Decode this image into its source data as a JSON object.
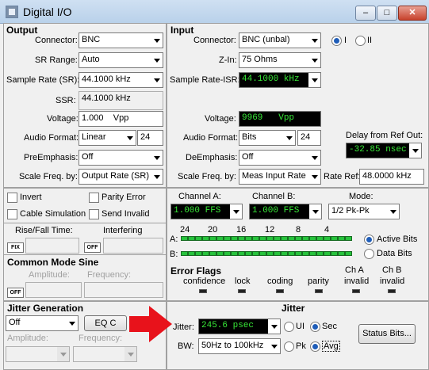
{
  "window": {
    "title": "Digital I/O",
    "minimize": "–",
    "maximize": "□",
    "close": "✕"
  },
  "output": {
    "title": "Output",
    "connector_label": "Connector:",
    "connector_value": "BNC",
    "sr_range_label": "SR Range:",
    "sr_range_value": "Auto",
    "sample_rate_label": "Sample Rate (SR):",
    "sample_rate_value": "44.1000 kHz",
    "ssr_label": "SSR:",
    "ssr_value": "44.1000 kHz",
    "voltage_label": "Voltage:",
    "voltage_value": "1.000",
    "voltage_unit": "Vpp",
    "audio_format_label": "Audio Format:",
    "audio_format_value": "Linear",
    "audio_format_bits": "24",
    "preemphasis_label": "PreEmphasis:",
    "preemphasis_value": "Off",
    "scale_freq_label": "Scale Freq. by:",
    "scale_freq_value": "Output Rate (SR)"
  },
  "input": {
    "title": "Input",
    "connector_label": "Connector:",
    "connector_value": "BNC (unbal)",
    "radio_i": "I",
    "radio_ii": "II",
    "zin_label": "Z-In:",
    "zin_value": "75 Ohms",
    "sample_rate_label": "Sample Rate-ISR:",
    "sample_rate_value": "44.1000 kHz",
    "voltage_label": "Voltage:",
    "voltage_value": "9969",
    "voltage_unit": "Vpp",
    "audio_format_label": "Audio Format:",
    "audio_format_value": "Bits",
    "audio_format_bits": "24",
    "deemphasis_label": "DeEmphasis:",
    "deemphasis_value": "Off",
    "scale_freq_label": "Scale Freq. by:",
    "scale_freq_value": "Meas Input Rate",
    "delay_label": "Delay from Ref Out:",
    "delay_value": "-32.85  nsec",
    "rate_ref_label": "Rate Ref:",
    "rate_ref_value": "48.0000 kHz"
  },
  "options": {
    "invert": "Invert",
    "parity_error": "Parity Error",
    "cable_simulation": "Cable Simulation",
    "send_invalid": "Send Invalid",
    "rise_fall_label": "Rise/Fall Time:",
    "interfering_label": "Interfering",
    "fix": "FIX",
    "off": "OFF",
    "common_mode_title": "Common Mode Sine",
    "amplitude_label": "Amplitude:",
    "frequency_label": "Frequency:"
  },
  "jitter_gen": {
    "title": "Jitter Generation",
    "mode_value": "Off",
    "eq_button": "EQ C",
    "amplitude_label": "Amplitude:",
    "frequency_label": "Frequency:"
  },
  "channels": {
    "channel_a_label": "Channel A:",
    "channel_a_value": "1.000     FFS",
    "channel_b_label": "Channel B:",
    "channel_b_value": "1.000     FFS",
    "mode_label": "Mode:",
    "mode_value": "1/2 Pk-Pk"
  },
  "bits": {
    "scale": [
      "24",
      "20",
      "16",
      "12",
      "8",
      "4"
    ],
    "row_a": "A:",
    "row_b": "B:",
    "active_bits": "Active Bits",
    "data_bits": "Data Bits"
  },
  "error_flags": {
    "title": "Error Flags",
    "items": [
      "confidence",
      "lock",
      "coding",
      "parity",
      "invalid",
      "invalid"
    ],
    "ch_a": "Ch A",
    "ch_b": "Ch B"
  },
  "jitter": {
    "title": "Jitter",
    "jitter_label": "Jitter:",
    "jitter_value": "245.6   psec",
    "ui": "UI",
    "sec": "Sec",
    "bw_label": "BW:",
    "bw_value": "50Hz to 100kHz",
    "pk": "Pk",
    "avg": "Avg",
    "status_bits": "Status Bits..."
  },
  "colors": {
    "led_active": "#27c23c",
    "green_text": "#37e837",
    "arrow": "#e8121b"
  }
}
